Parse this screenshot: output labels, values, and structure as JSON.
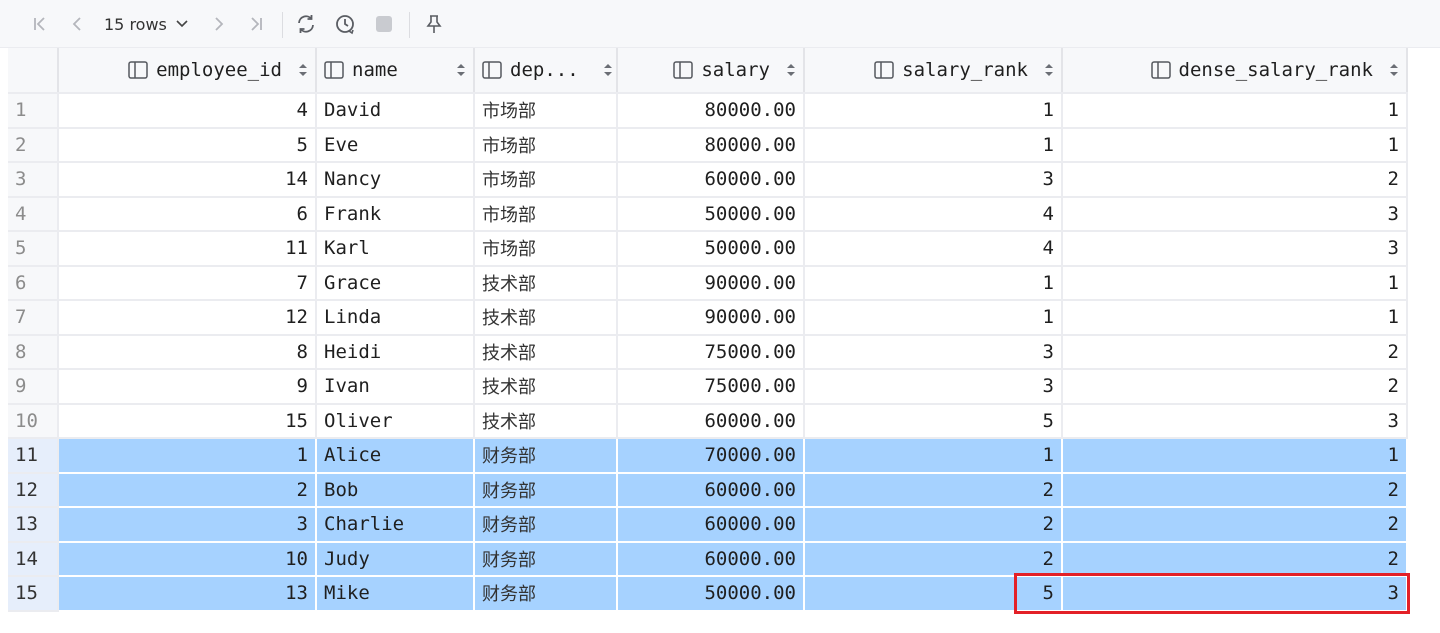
{
  "toolbar": {
    "rows_label": "15 rows",
    "icons": [
      "first-page-icon",
      "prev-page-icon",
      "chevron-down-icon",
      "next-page-icon",
      "last-page-icon",
      "refresh-icon",
      "history-icon",
      "stop-icon",
      "pin-icon"
    ]
  },
  "columns": [
    {
      "label": "employee_id",
      "align": "right"
    },
    {
      "label": "name",
      "align": "left"
    },
    {
      "label": "dep...",
      "align": "left"
    },
    {
      "label": "salary",
      "align": "right"
    },
    {
      "label": "salary_rank",
      "align": "right"
    },
    {
      "label": "dense_salary_rank",
      "align": "right"
    }
  ],
  "rows": [
    {
      "n": "1",
      "employee_id": "4",
      "name": "David",
      "dep": "市场部",
      "salary": "80000.00",
      "salary_rank": "1",
      "dense_salary_rank": "1"
    },
    {
      "n": "2",
      "employee_id": "5",
      "name": "Eve",
      "dep": "市场部",
      "salary": "80000.00",
      "salary_rank": "1",
      "dense_salary_rank": "1"
    },
    {
      "n": "3",
      "employee_id": "14",
      "name": "Nancy",
      "dep": "市场部",
      "salary": "60000.00",
      "salary_rank": "3",
      "dense_salary_rank": "2"
    },
    {
      "n": "4",
      "employee_id": "6",
      "name": "Frank",
      "dep": "市场部",
      "salary": "50000.00",
      "salary_rank": "4",
      "dense_salary_rank": "3"
    },
    {
      "n": "5",
      "employee_id": "11",
      "name": "Karl",
      "dep": "市场部",
      "salary": "50000.00",
      "salary_rank": "4",
      "dense_salary_rank": "3"
    },
    {
      "n": "6",
      "employee_id": "7",
      "name": "Grace",
      "dep": "技术部",
      "salary": "90000.00",
      "salary_rank": "1",
      "dense_salary_rank": "1"
    },
    {
      "n": "7",
      "employee_id": "12",
      "name": "Linda",
      "dep": "技术部",
      "salary": "90000.00",
      "salary_rank": "1",
      "dense_salary_rank": "1"
    },
    {
      "n": "8",
      "employee_id": "8",
      "name": "Heidi",
      "dep": "技术部",
      "salary": "75000.00",
      "salary_rank": "3",
      "dense_salary_rank": "2"
    },
    {
      "n": "9",
      "employee_id": "9",
      "name": "Ivan",
      "dep": "技术部",
      "salary": "75000.00",
      "salary_rank": "3",
      "dense_salary_rank": "2"
    },
    {
      "n": "10",
      "employee_id": "15",
      "name": "Oliver",
      "dep": "技术部",
      "salary": "60000.00",
      "salary_rank": "5",
      "dense_salary_rank": "3"
    },
    {
      "n": "11",
      "employee_id": "1",
      "name": "Alice",
      "dep": "财务部",
      "salary": "70000.00",
      "salary_rank": "1",
      "dense_salary_rank": "1",
      "selected": true
    },
    {
      "n": "12",
      "employee_id": "2",
      "name": "Bob",
      "dep": "财务部",
      "salary": "60000.00",
      "salary_rank": "2",
      "dense_salary_rank": "2",
      "selected": true
    },
    {
      "n": "13",
      "employee_id": "3",
      "name": "Charlie",
      "dep": "财务部",
      "salary": "60000.00",
      "salary_rank": "2",
      "dense_salary_rank": "2",
      "selected": true
    },
    {
      "n": "14",
      "employee_id": "10",
      "name": "Judy",
      "dep": "财务部",
      "salary": "60000.00",
      "salary_rank": "2",
      "dense_salary_rank": "2",
      "selected": true
    },
    {
      "n": "15",
      "employee_id": "13",
      "name": "Mike",
      "dep": "财务部",
      "salary": "50000.00",
      "salary_rank": "5",
      "dense_salary_rank": "3",
      "selected": true
    }
  ],
  "colors": {
    "selection": "#a6d2ff",
    "highlight": "#e32028"
  }
}
